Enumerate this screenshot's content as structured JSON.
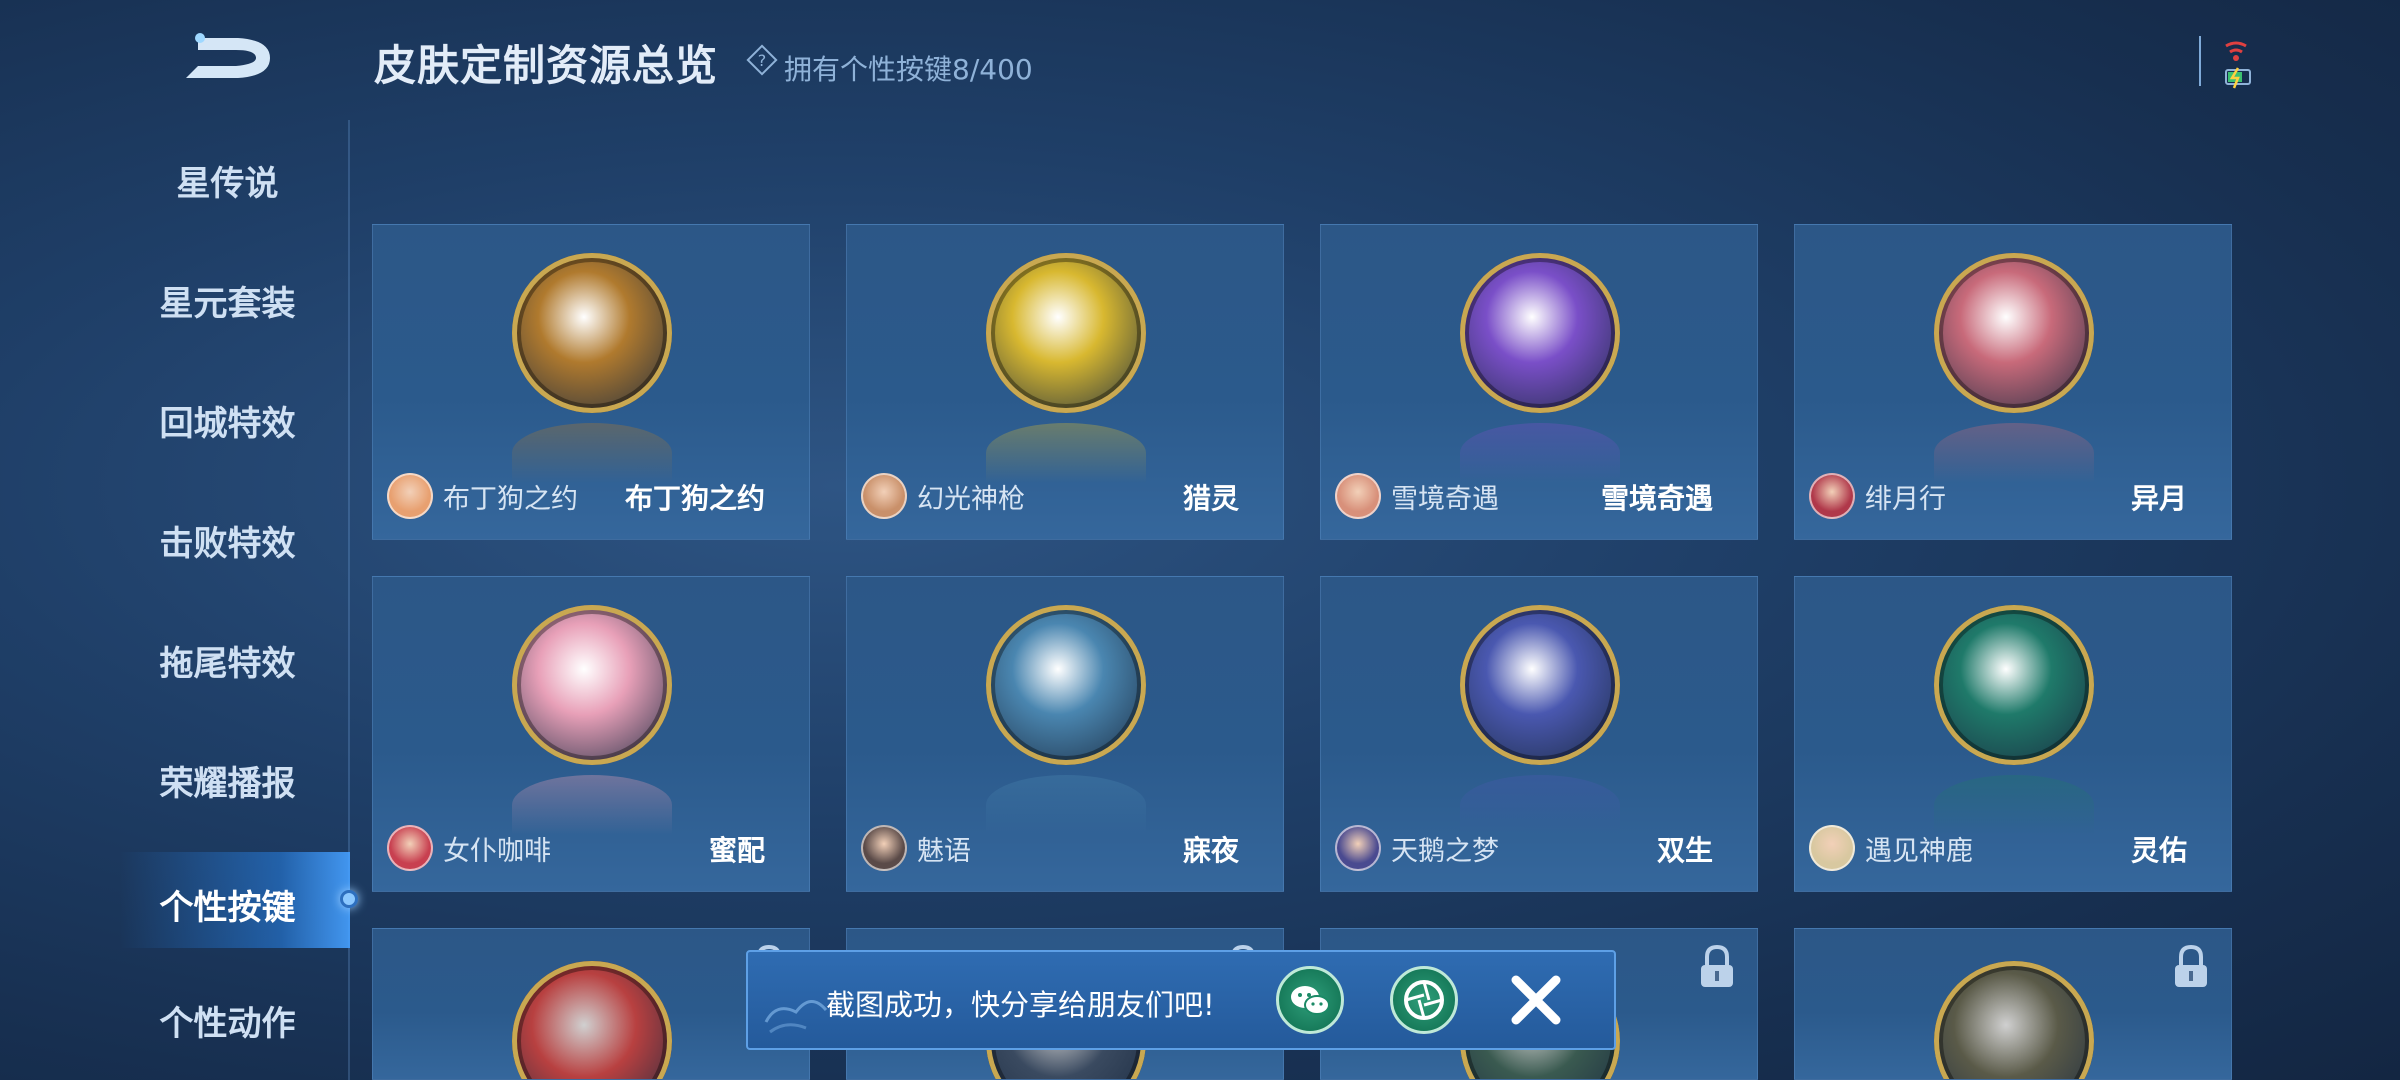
{
  "header": {
    "title": "皮肤定制资源总览",
    "owned_label": "拥有个性按键",
    "owned_count": "8",
    "owned_total": "/400"
  },
  "sidebar": {
    "items": [
      {
        "label": "星传说"
      },
      {
        "label": "星元套装"
      },
      {
        "label": "回城特效"
      },
      {
        "label": "击败特效"
      },
      {
        "label": "拖尾特效"
      },
      {
        "label": "荣耀播报"
      },
      {
        "label": "个性按键",
        "active": true
      },
      {
        "label": "个性动作"
      }
    ]
  },
  "cards": [
    {
      "skin": "布丁狗之约",
      "name": "布丁狗之约",
      "badge_color": "#b07a2e",
      "avatar_color": "#e8a070"
    },
    {
      "skin": "幻光神枪",
      "name": "猎灵",
      "badge_color": "#d8b830",
      "avatar_color": "#c9906a"
    },
    {
      "skin": "雪境奇遇",
      "name": "雪境奇遇",
      "badge_color": "#7a4fc8",
      "avatar_color": "#d8907a"
    },
    {
      "skin": "绯月行",
      "name": "异月",
      "badge_color": "#c86a7a",
      "avatar_color": "#b0384a"
    },
    {
      "skin": "女仆咖啡",
      "name": "蜜配",
      "badge_color": "#e8a0b8",
      "avatar_color": "#c84050"
    },
    {
      "skin": "魅语",
      "name": "寐夜",
      "badge_color": "#4a86b0",
      "avatar_color": "#5a4a48"
    },
    {
      "skin": "天鹅之梦",
      "name": "双生",
      "badge_color": "#4a58b0",
      "avatar_color": "#4a4a90"
    },
    {
      "skin": "遇见神鹿",
      "name": "灵佑",
      "badge_color": "#1f7a6a",
      "avatar_color": "#d8c8a0"
    }
  ],
  "locked_row": [
    {
      "badge_color": "#b84040"
    },
    {
      "badge_color": "#3a4a60"
    },
    {
      "badge_color": "#3a5a50"
    },
    {
      "badge_color": "#5a5a48"
    }
  ],
  "toast": {
    "message": "截图成功，快分享给朋友们吧!",
    "share_wechat": "wechat-icon",
    "share_moments": "moments-icon",
    "close": "close-icon"
  }
}
